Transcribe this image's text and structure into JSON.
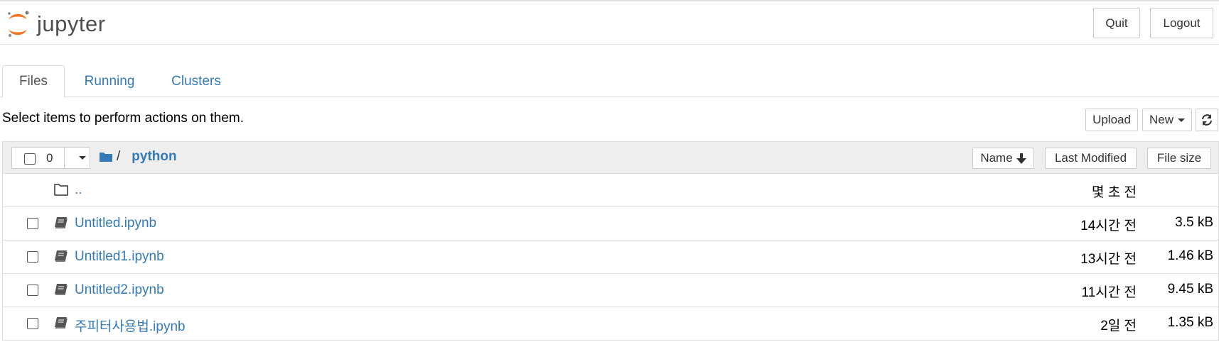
{
  "header": {
    "logo_text": "jupyter",
    "quit_label": "Quit",
    "logout_label": "Logout"
  },
  "tabs": [
    {
      "label": "Files",
      "active": true
    },
    {
      "label": "Running",
      "active": false
    },
    {
      "label": "Clusters",
      "active": false
    }
  ],
  "toolbar": {
    "hint": "Select items to perform actions on them.",
    "upload_label": "Upload",
    "new_label": "New",
    "refresh_icon": "refresh-icon"
  },
  "list_header": {
    "selected_count": "0",
    "breadcrumb_sep": "/",
    "current_dir": "python",
    "sort_name_label": "Name",
    "sort_modified_label": "Last Modified",
    "sort_size_label": "File size"
  },
  "files": [
    {
      "name": "..",
      "type": "folder",
      "modified": "몇 초 전",
      "size": ""
    },
    {
      "name": "Untitled.ipynb",
      "type": "notebook",
      "modified": "14시간 전",
      "size": "3.5 kB"
    },
    {
      "name": "Untitled1.ipynb",
      "type": "notebook",
      "modified": "13시간 전",
      "size": "1.46 kB"
    },
    {
      "name": "Untitled2.ipynb",
      "type": "notebook",
      "modified": "11시간 전",
      "size": "9.45 kB"
    },
    {
      "name": "주피터사용법.ipynb",
      "type": "notebook",
      "modified": "2일 전",
      "size": "1.35 kB"
    }
  ],
  "colors": {
    "link": "#337ab7",
    "logo_orange": "#F37726",
    "header_bg": "#eeeeee"
  }
}
